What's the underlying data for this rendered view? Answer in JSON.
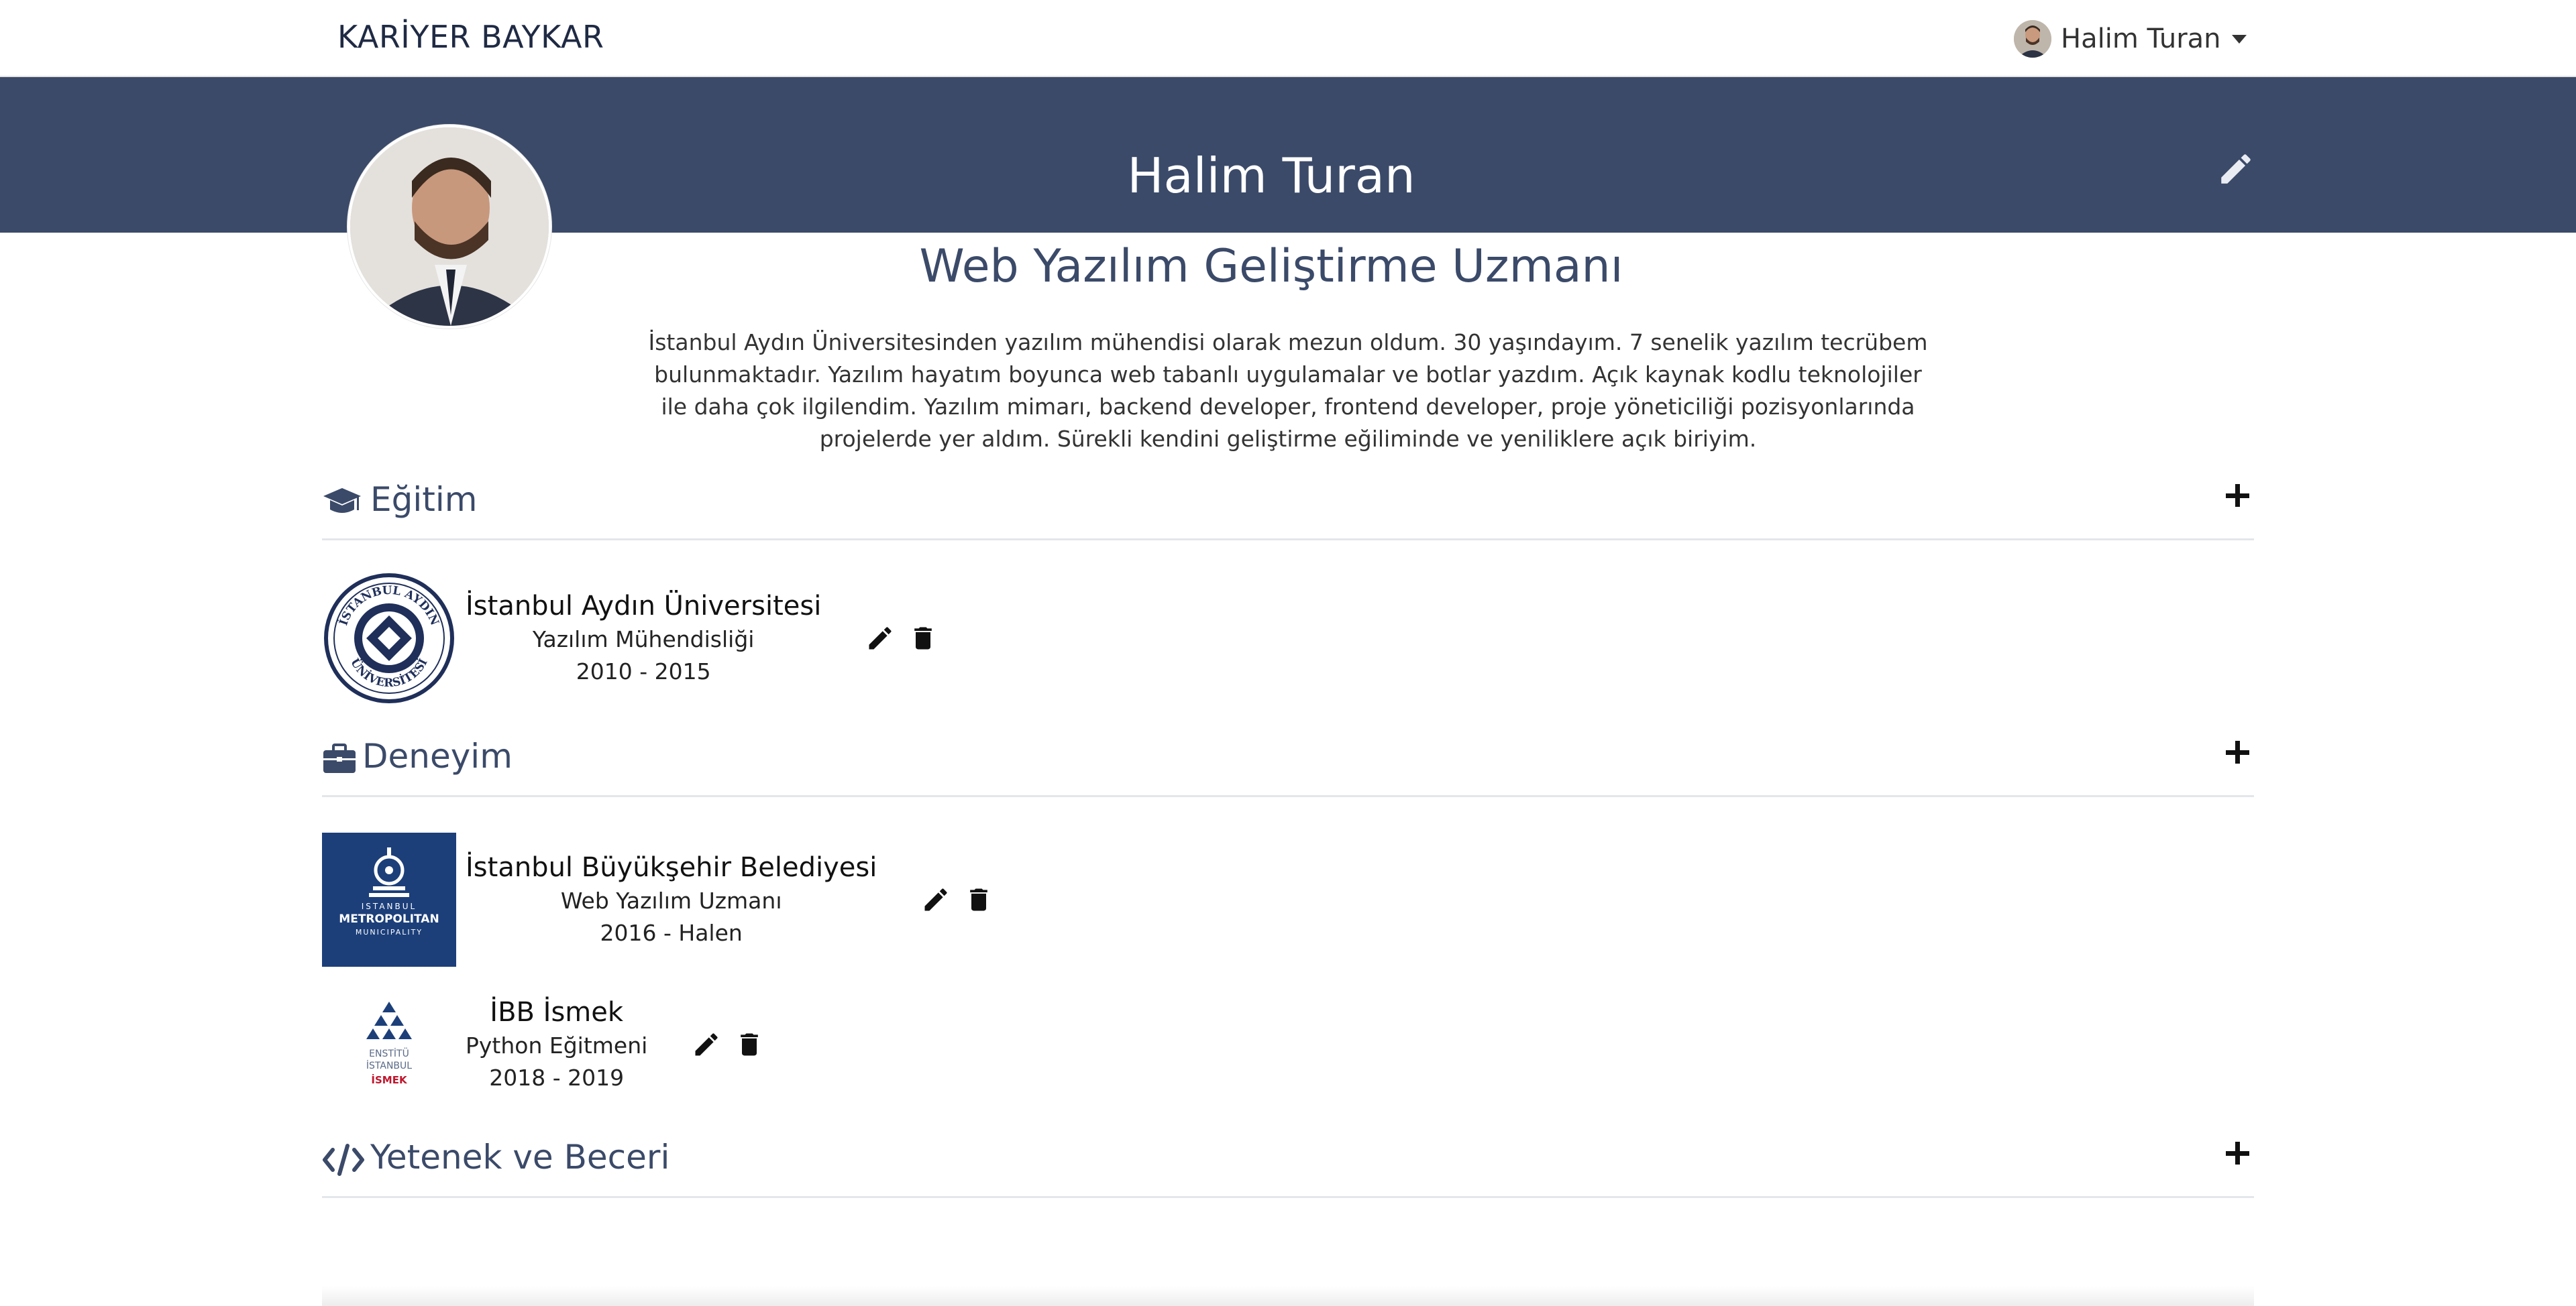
{
  "navbar": {
    "brand": "KARİYER BAYKAR",
    "user_name": "Halim Turan"
  },
  "profile": {
    "name": "Halim Turan",
    "headline": "Web Yazılım Geliştirme Uzmanı",
    "summary": "İstanbul Aydın Üniversitesinden yazılım mühendisi olarak mezun oldum. 30 yaşındayım. 7 senelik yazılım tecrübem bulunmaktadır. Yazılım hayatım boyunca web tabanlı uygulamalar ve botlar yazdım. Açık kaynak kodlu teknolojiler ile daha çok ilgilendim. Yazılım mimarı, backend developer, frontend developer, proje yöneticiliği pozisyonlarında projelerde yer aldım. Sürekli kendini geliştirme eğiliminde ve yeniliklere açık biriyim."
  },
  "sections": {
    "education": {
      "title": "Eğitim",
      "items": [
        {
          "title": "İstanbul Aydın Üniversitesi",
          "subtitle": "Yazılım Mühendisliği",
          "dates": "2010 - 2015"
        }
      ]
    },
    "experience": {
      "title": "Deneyim",
      "items": [
        {
          "title": "İstanbul Büyükşehir Belediyesi",
          "subtitle": "Web Yazılım Uzmanı",
          "dates": "2016 - Halen"
        },
        {
          "title": "İBB İsmek",
          "subtitle": "Python Eğitmeni",
          "dates": "2018 - 2019"
        }
      ]
    },
    "skills": {
      "title": "Yetenek ve Beceri"
    }
  },
  "logos": {
    "iau_ring_top": "İSTANBUL AYDIN",
    "iau_ring_bottom": "ÜNİVERSİTESİ",
    "ibb_lines": [
      "ISTANBUL",
      "METROPOLITAN",
      "MUNICIPALITY"
    ],
    "ismek_lines": [
      "ENSTİTÜ",
      "İSTANBUL",
      "İSMEK"
    ]
  },
  "colors": {
    "banner": "#3b4a69",
    "accent_text": "#3b4a69",
    "ibb_blue": "#1c3f7a",
    "ismek_red": "#c0162c"
  },
  "icons": {
    "education": "graduation-cap-icon",
    "experience": "briefcase-icon",
    "skills": "code-icon",
    "edit": "pencil-icon",
    "delete": "trash-icon",
    "add": "plus-icon"
  }
}
